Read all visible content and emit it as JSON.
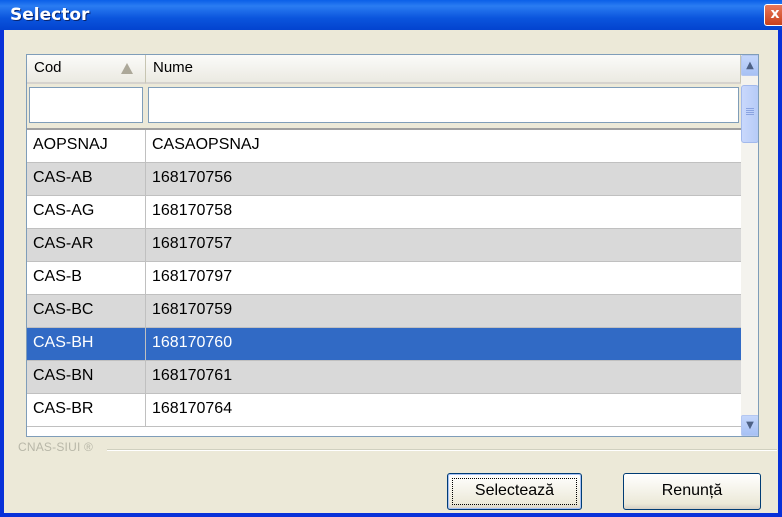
{
  "window": {
    "title": "Selector",
    "close_symbol": "x"
  },
  "grid": {
    "columns": [
      {
        "label": "Cod",
        "sort": "ascending"
      },
      {
        "label": "Nume"
      }
    ],
    "filters": {
      "cod": "",
      "nume": ""
    },
    "rows": [
      {
        "cod": "AOPSNAJ",
        "nume": "CASAOPSNAJ",
        "style": "normal"
      },
      {
        "cod": "CAS-AB",
        "nume": "168170756",
        "style": "alt"
      },
      {
        "cod": "CAS-AG",
        "nume": "168170758",
        "style": "normal"
      },
      {
        "cod": "CAS-AR",
        "nume": "168170757",
        "style": "alt"
      },
      {
        "cod": "CAS-B",
        "nume": "168170797",
        "style": "normal"
      },
      {
        "cod": "CAS-BC",
        "nume": "168170759",
        "style": "alt"
      },
      {
        "cod": "CAS-BH",
        "nume": "168170760",
        "style": "selected"
      },
      {
        "cod": "CAS-BN",
        "nume": "168170761",
        "style": "alt"
      },
      {
        "cod": "CAS-BR",
        "nume": "168170764",
        "style": "normal"
      }
    ],
    "selected_row": 6
  },
  "branding": {
    "text": "CNAS-SIUI ®"
  },
  "buttons": {
    "select_label": "Selectează",
    "cancel_label": "Renunță"
  },
  "colors": {
    "title_bar": "#0a5fe8",
    "selection": "#316ac5",
    "alt_row": "#d9d9d9",
    "dialog_bg": "#ece9d8"
  }
}
